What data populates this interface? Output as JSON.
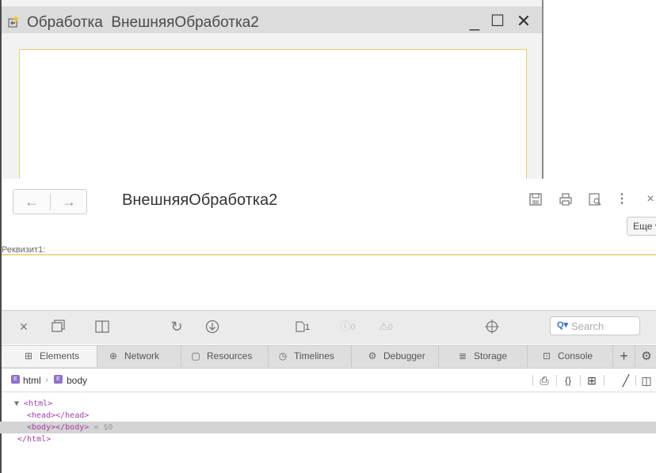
{
  "onec_window": {
    "title": "Обработка  ВнешняяОбработка2",
    "minimize_glyph": "_",
    "maximize_glyph": "☐",
    "close_glyph": "✕"
  },
  "form": {
    "back_glyph": "←",
    "forward_glyph": "→",
    "title": "ВнешняяОбработка2",
    "more_button": "Еще ▾",
    "field_label": "Реквизит1:",
    "field_value": "",
    "toolbar_icons": [
      "save-icon",
      "print-icon",
      "preview-icon",
      "kebab-menu-icon",
      "close-icon"
    ]
  },
  "devtools": {
    "toolbar": {
      "resource_count": "1",
      "error_count": "0",
      "warning_count": "0",
      "search_placeholder": "Search"
    },
    "tabs": [
      {
        "label": "Elements",
        "icon": "elements-icon",
        "active": true
      },
      {
        "label": "Network",
        "icon": "network-icon"
      },
      {
        "label": "Resources",
        "icon": "resources-icon"
      },
      {
        "label": "Timelines",
        "icon": "timelines-icon"
      },
      {
        "label": "Debugger",
        "icon": "debugger-icon"
      },
      {
        "label": "Storage",
        "icon": "storage-icon"
      },
      {
        "label": "Console",
        "icon": "console-icon"
      }
    ],
    "breadcrumbs": [
      "html",
      "body"
    ],
    "dom_tree": [
      {
        "text": "<html>"
      },
      {
        "text": "<head></head>"
      },
      {
        "text": "<body></body>",
        "suffix": "= $0",
        "selected": true
      },
      {
        "text": "</html>"
      }
    ]
  },
  "colors": {
    "onec_border_accent": "#e6cf7a",
    "tag_color": "#a340a8",
    "breadcrumb_chip": "#8e71c9",
    "search_accent": "#3a70c8"
  }
}
